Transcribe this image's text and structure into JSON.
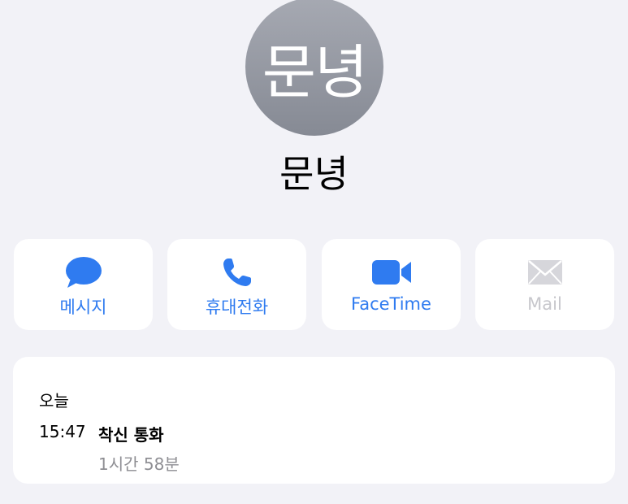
{
  "contact": {
    "avatar_initials": "문녕",
    "name": "문녕"
  },
  "actions": [
    {
      "label": "메시지",
      "icon": "message-bubble-icon",
      "enabled": true
    },
    {
      "label": "휴대전화",
      "icon": "phone-icon",
      "enabled": true
    },
    {
      "label": "FaceTime",
      "icon": "video-camera-icon",
      "enabled": true
    },
    {
      "label": "Mail",
      "icon": "envelope-icon",
      "enabled": false
    }
  ],
  "history": {
    "day": "오늘",
    "entries": [
      {
        "time": "15:47",
        "type": "착신 통화",
        "duration": "1시간 58분"
      }
    ]
  },
  "colors": {
    "background": "#f2f2f7",
    "accent": "#2f7bf0",
    "disabled": "#c7c7cc",
    "secondary_text": "#8e8e93",
    "avatar": "#9a9da6"
  }
}
